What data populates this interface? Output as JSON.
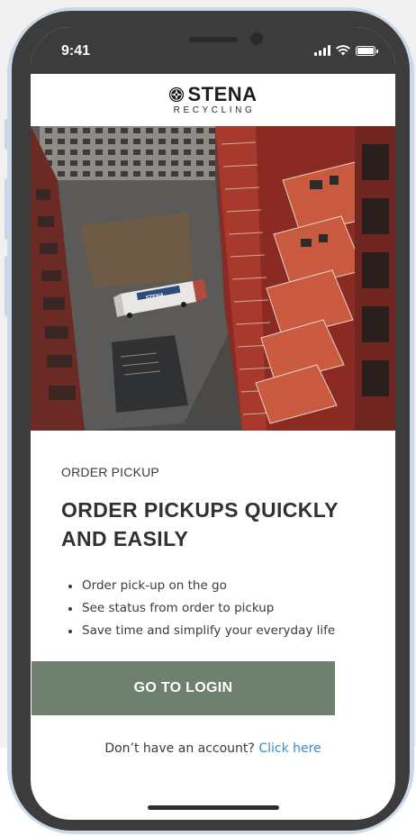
{
  "status_bar": {
    "time": "9:41",
    "icons": [
      "signal-icon",
      "wifi-icon",
      "battery-icon"
    ]
  },
  "brand": {
    "name": "STENA",
    "subtitle": "RECYCLING",
    "logo_icon": "stena-logo-icon"
  },
  "hero": {
    "truck_text": "STENA"
  },
  "content": {
    "eyebrow": "ORDER PICKUP",
    "headline": "ORDER PICKUPS QUICKLY AND EASILY",
    "bullets": [
      "Order pick-up on the go",
      "See status from order to pickup",
      "Save time and simplify your everyday life"
    ]
  },
  "actions": {
    "login_label": "GO TO LOGIN",
    "signup_prompt": "Don’t have an account?",
    "signup_link": "Click here"
  },
  "colors": {
    "button": "#6f806e",
    "link": "#3a8ec4",
    "text": "#2f3133",
    "phone_frame": "#3c3c3c"
  }
}
